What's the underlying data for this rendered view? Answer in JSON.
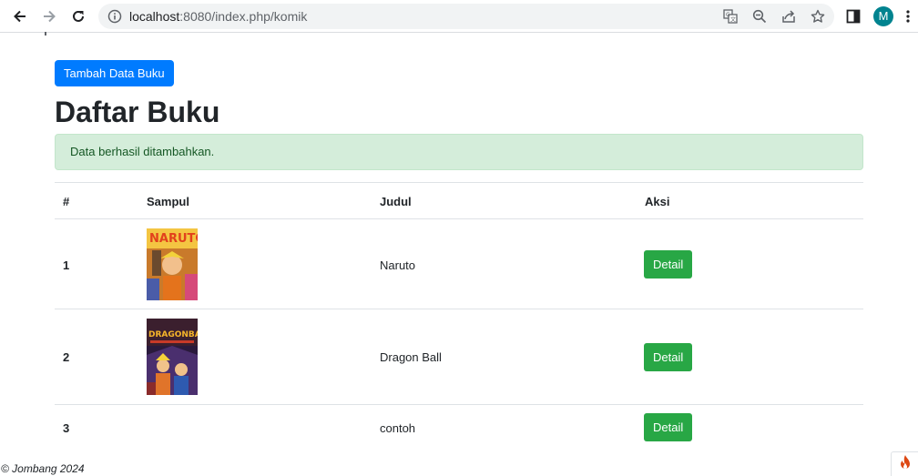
{
  "browser": {
    "url_host": "localhost",
    "url_rest": ":8080/index.php/komik",
    "avatar_initial": "M",
    "avatar_color": "#00838f",
    "icons": [
      "back-arrow-icon",
      "forward-arrow-icon",
      "reload-icon",
      "info-icon",
      "translate-icon",
      "zoom-out-icon",
      "share-icon",
      "bookmark-star-icon",
      "side-panel-icon",
      "kebab-menu-icon"
    ]
  },
  "page": {
    "add_button_label": "Tambah Data Buku",
    "title": "Daftar Buku",
    "alert_text": "Data berhasil ditambahkan.",
    "table": {
      "headers": [
        "#",
        "Sampul",
        "Judul",
        "Aksi"
      ],
      "rows": [
        {
          "number": "1",
          "title": "Naruto",
          "cover": "naruto-cover",
          "action": "Detail"
        },
        {
          "number": "2",
          "title": "Dragon Ball",
          "cover": "dragon-ball-cover",
          "action": "Detail"
        },
        {
          "number": "3",
          "title": "contoh",
          "cover": "",
          "action": "Detail"
        }
      ]
    },
    "footer": "© Jombang 2024"
  },
  "colors": {
    "primary": "#007bff",
    "success": "#28a745",
    "alert_bg": "#d4edda",
    "alert_border": "#c3e6cb",
    "alert_text": "#155724",
    "ci_flame": "#dd4814"
  }
}
